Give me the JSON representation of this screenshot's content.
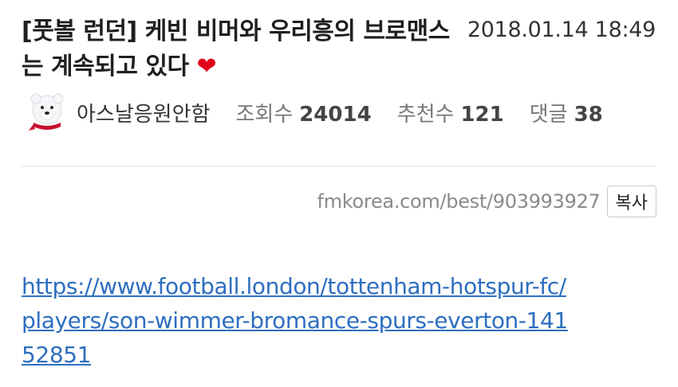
{
  "post": {
    "title": "[풋볼 런던] 케빈 비머와 우리흥의 브로맨스는 계속되고 있다",
    "title_emoji": "❤",
    "date": "2018.01.14 18:49",
    "author": "아스날응원안함",
    "views_label": "조회수",
    "views": "24014",
    "recommend_label": "추천수",
    "recommend": "121",
    "comments_label": "댓글",
    "comments": "38"
  },
  "share": {
    "short_url": "fmkorea.com/best/903993927",
    "copy_label": "복사"
  },
  "content": {
    "link_text": "https://www.football.london/tottenham-hotspur-fc/players/son-wimmer-bromance-spurs-everton-14152851"
  }
}
